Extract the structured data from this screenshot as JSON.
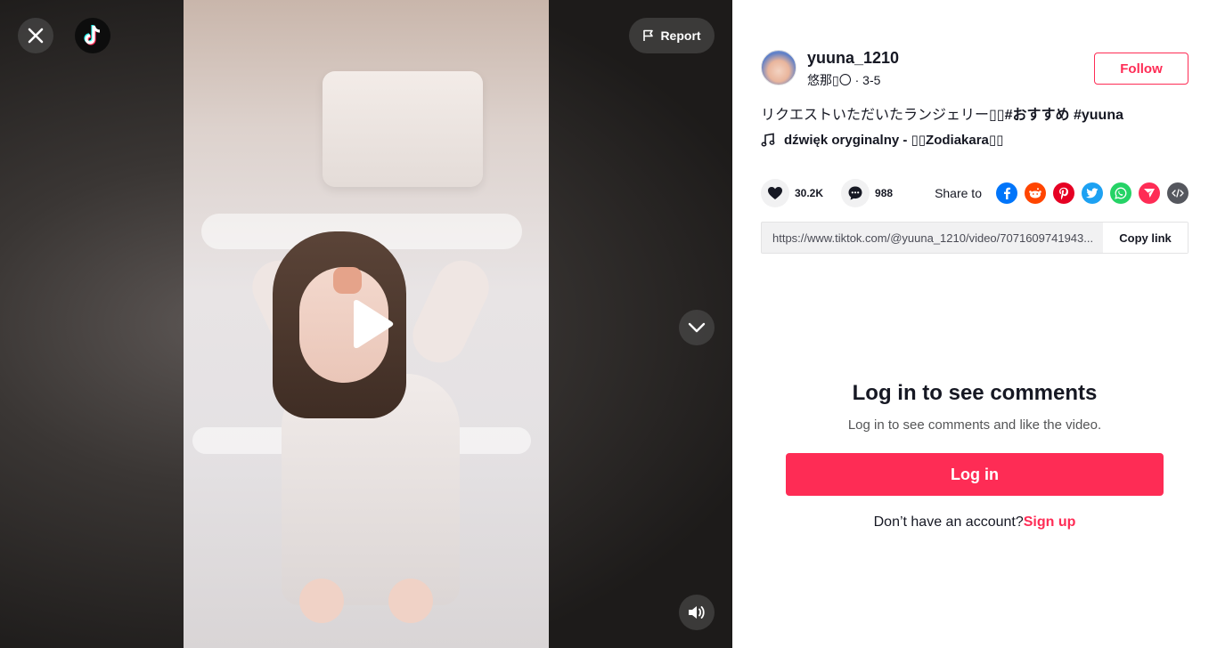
{
  "header": {
    "report_label": "Report"
  },
  "author": {
    "username": "yuuna_1210",
    "nickname": "悠那▯〇",
    "date": "3-5",
    "follow_label": "Follow"
  },
  "caption": {
    "text": "リクエストいただいたランジェリー▯▯",
    "tag1": "#おすすめ",
    "tag2": "#yuuna"
  },
  "music": {
    "title": "dźwięk oryginalny - ▯▯Zodiakara▯▯"
  },
  "stats": {
    "likes": "30.2K",
    "comments": "988"
  },
  "share": {
    "label": "Share to",
    "icons": [
      "facebook-icon",
      "reddit-icon",
      "pinterest-icon",
      "twitter-icon",
      "whatsapp-icon",
      "telegram-icon",
      "embed-icon"
    ]
  },
  "link": {
    "url": "https://www.tiktok.com/@yuuna_1210/video/7071609741943...",
    "copy_label": "Copy link"
  },
  "login": {
    "title": "Log in to see comments",
    "subtitle": "Log in to see comments and like the video.",
    "button_label": "Log in",
    "no_account_text": "Don’t have an account?",
    "signup_label": "Sign up"
  },
  "colors": {
    "accent": "#fe2c55",
    "facebook": "#0075fa",
    "reddit": "#ff4500",
    "pinterest": "#e60023",
    "twitter": "#1da1f2",
    "whatsapp": "#25d366",
    "telegram": "#fe2c55",
    "embed": "#55575e"
  }
}
